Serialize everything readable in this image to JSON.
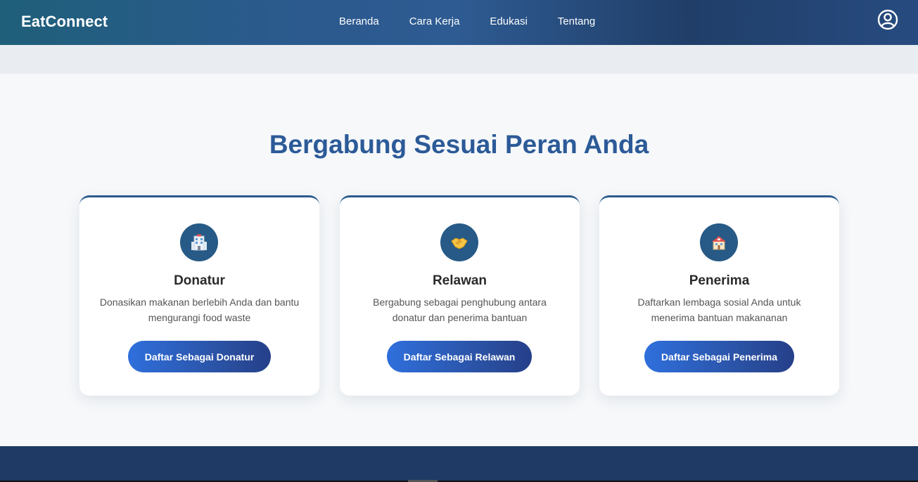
{
  "header": {
    "brand": "EatConnect",
    "nav": [
      "Beranda",
      "Cara Kerja",
      "Edukasi",
      "Tentang"
    ],
    "profile_icon": "user-circle-icon"
  },
  "section": {
    "title": "Bergabung Sesuai Peran Anda"
  },
  "cards": [
    {
      "icon": "office-building-icon",
      "title": "Donatur",
      "desc_line1": "Donasikan makanan berlebih Anda dan bantu",
      "desc_line2": "mengurangi food waste",
      "button": "Daftar Sebagai Donatur"
    },
    {
      "icon": "handshake-icon",
      "title": "Relawan",
      "desc_line1": "Bergabung sebagai penghubung antara",
      "desc_line2": "donatur dan penerima bantuan",
      "button": "Daftar Sebagai Relawan"
    },
    {
      "icon": "house-icon",
      "title": "Penerima",
      "desc_line1": "Daftarkan lembaga sosial Anda untuk",
      "desc_line2": "menerima bantuan makananan",
      "button": "Daftar Sebagai Penerima"
    }
  ],
  "colors": {
    "accent": "#2c5a98",
    "navbar": "#2b5a8d",
    "footer": "#1f3a64"
  }
}
